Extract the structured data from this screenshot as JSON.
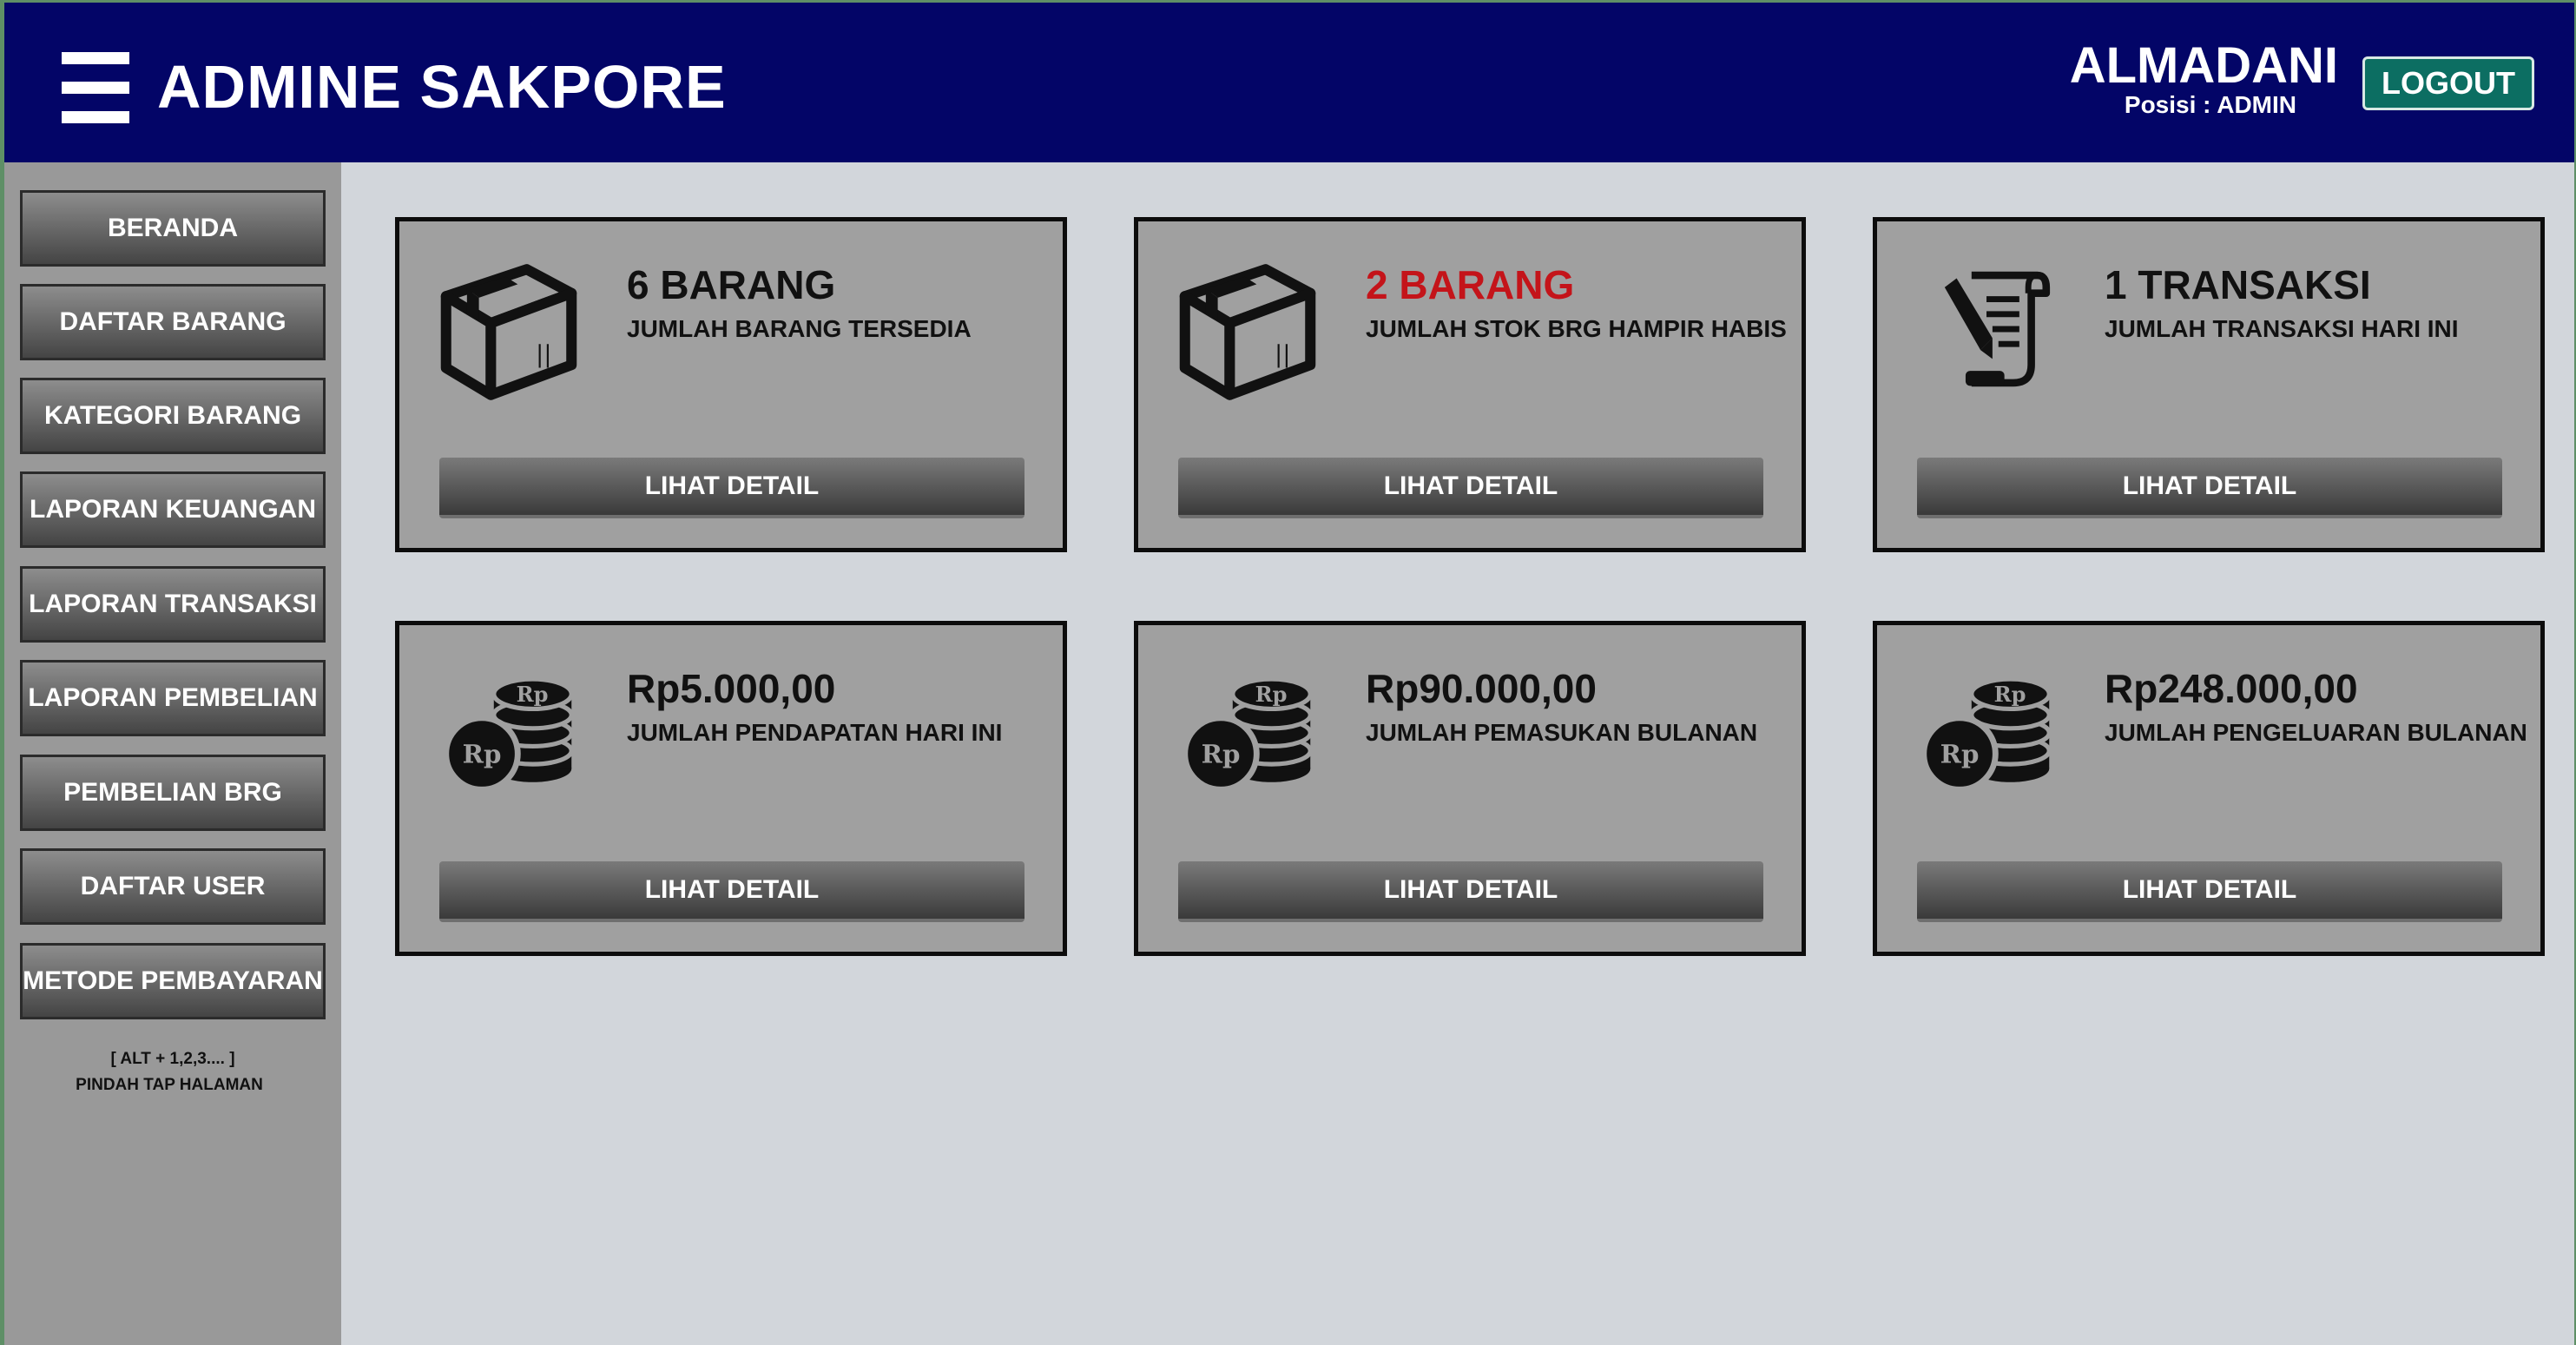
{
  "app": {
    "title": "ADMINE SAKPORE"
  },
  "user": {
    "name": "ALMADANI",
    "role_text": "Posisi : ADMIN",
    "logout_label": "LOGOUT"
  },
  "colors": {
    "header": "#030567",
    "sidebar": "#999999",
    "content_bg": "#d2d6db",
    "logout": "#0c6e62",
    "alert": "#c4141a",
    "card_bg": "#a0a0a0"
  },
  "sidebar": {
    "items": [
      {
        "label": "BERANDA"
      },
      {
        "label": "DAFTAR BARANG"
      },
      {
        "label": "KATEGORI BARANG"
      },
      {
        "label": "LAPORAN KEUANGAN"
      },
      {
        "label": "LAPORAN TRANSAKSI"
      },
      {
        "label": "LAPORAN PEMBELIAN"
      },
      {
        "label": "PEMBELIAN BRG"
      },
      {
        "label": "DAFTAR USER"
      },
      {
        "label": "METODE PEMBAYARAN"
      }
    ],
    "hint_line1": "[ ALT + 1,2,3.... ]",
    "hint_line2": "PINDAH TAP HALAMAN"
  },
  "cards": [
    {
      "icon": "box-icon",
      "value": "6 BARANG",
      "label": "JUMLAH BARANG TERSEDIA",
      "button": "LIHAT DETAIL"
    },
    {
      "icon": "box-icon",
      "value": "2 BARANG",
      "label": "JUMLAH STOK BRG HAMPIR HABIS",
      "button": "LIHAT DETAIL"
    },
    {
      "icon": "scroll-quill-icon",
      "value": "1 TRANSAKSI",
      "label": "JUMLAH TRANSAKSI HARI INI",
      "button": "LIHAT DETAIL"
    },
    {
      "icon": "rupiah-coins-icon",
      "value": "Rp5.000,00",
      "label": "JUMLAH PENDAPATAN HARI INI",
      "button": "LIHAT DETAIL"
    },
    {
      "icon": "rupiah-coins-icon",
      "value": "Rp90.000,00",
      "label": "JUMLAH PEMASUKAN BULANAN",
      "button": "LIHAT DETAIL"
    },
    {
      "icon": "rupiah-coins-icon",
      "value": "Rp248.000,00",
      "label": "JUMLAH PENGELUARAN BULANAN",
      "button": "LIHAT DETAIL"
    }
  ],
  "icons": {
    "box_text": "||",
    "coin_text": "Rp"
  }
}
